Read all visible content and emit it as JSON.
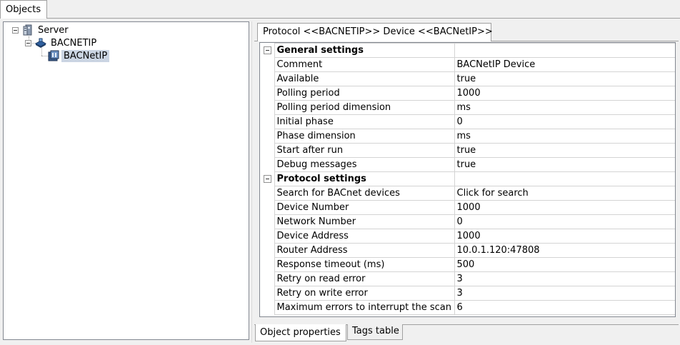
{
  "window": {
    "top_tab": "Objects"
  },
  "tree": {
    "nodes": [
      {
        "label": "Server",
        "icon": "server-icon"
      },
      {
        "label": "BACNETIP",
        "icon": "protocol-icon"
      },
      {
        "label": "BACNetIP",
        "icon": "device-icon"
      }
    ]
  },
  "properties": {
    "tab_title": "Protocol <<BACNETIP>> Device <<BACNetIP>>",
    "groups": [
      {
        "title": "General settings",
        "rows": [
          {
            "name": "Comment",
            "value": "BACNetIP Device"
          },
          {
            "name": "Available",
            "value": "true"
          },
          {
            "name": "Polling period",
            "value": "1000"
          },
          {
            "name": "Polling period dimension",
            "value": "ms"
          },
          {
            "name": "Initial phase",
            "value": "0"
          },
          {
            "name": "Phase dimension",
            "value": "ms"
          },
          {
            "name": "Start after run",
            "value": "true"
          },
          {
            "name": "Debug messages",
            "value": "true"
          }
        ]
      },
      {
        "title": "Protocol settings",
        "rows": [
          {
            "name": "Search for BACnet devices",
            "value": "Click for search"
          },
          {
            "name": "Device Number",
            "value": "1000"
          },
          {
            "name": "Network Number",
            "value": "0"
          },
          {
            "name": "Device Address",
            "value": "1000"
          },
          {
            "name": "Router Address",
            "value": "10.0.1.120:47808"
          },
          {
            "name": "Response timeout (ms)",
            "value": "500"
          },
          {
            "name": "Retry on read error",
            "value": "3"
          },
          {
            "name": "Retry on write error",
            "value": "3"
          },
          {
            "name": "Maximum errors to interrupt the scan",
            "value": "6"
          }
        ]
      }
    ]
  },
  "bottom_tabs": [
    {
      "label": "Object properties"
    },
    {
      "label": "Tags table"
    }
  ],
  "colors": {
    "selection": "#cbd5e3",
    "border": "#a0a0a0",
    "panel_bg": "#f0f0f0"
  }
}
